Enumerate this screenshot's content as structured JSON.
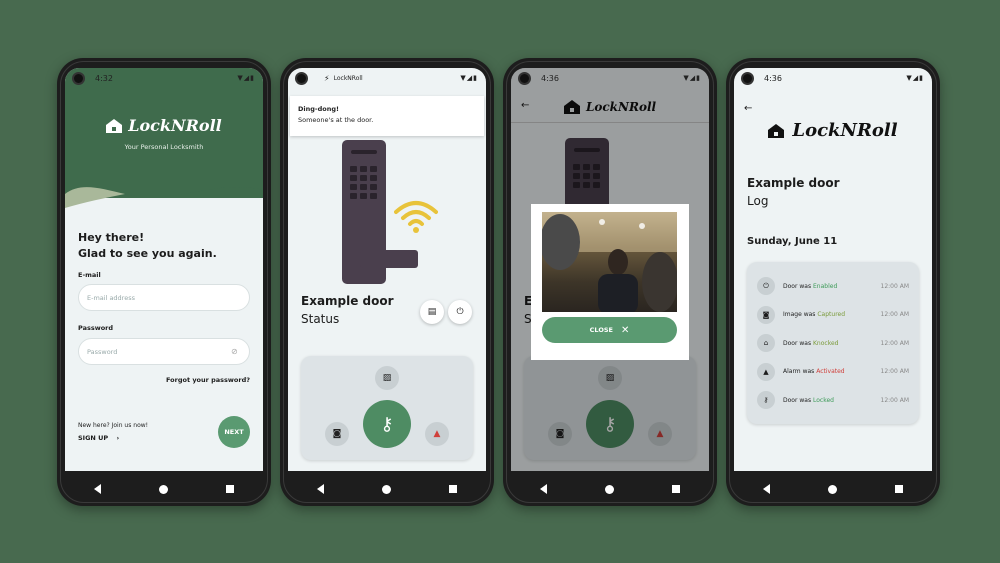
{
  "colors": {
    "background": "#486a4f",
    "brand": "#3f6b4c",
    "accent": "#5a9a71",
    "danger": "#d0403b"
  },
  "app": {
    "name": "LockNRoll",
    "tagline": "Your Personal Locksmith"
  },
  "screen1": {
    "time": "4:32",
    "greeting_line1": "Hey there!",
    "greeting_line2": "Glad to see you again.",
    "email_label": "E-mail",
    "email_placeholder": "E-mail address",
    "password_label": "Password",
    "password_placeholder": "Password",
    "forgot": "Forgot your password?",
    "new_here": "New here? Join us now!",
    "signup": "SIGN UP",
    "next": "NEXT"
  },
  "screen2": {
    "notif_app": "LockNRoll",
    "notif_title": "Ding-dong!",
    "notif_body": "Someone's at the door.",
    "door_title": "Example door",
    "door_subtitle": "Status"
  },
  "screen3": {
    "time": "4:36",
    "close": "CLOSE"
  },
  "screen4": {
    "time": "4:36",
    "title": "Example door",
    "subtitle": "Log",
    "date": "Sunday, June 11",
    "entries": [
      {
        "icon": "power-icon",
        "subject": "Door",
        "verb": "was",
        "action": "Enabled",
        "time": "12:00 AM"
      },
      {
        "icon": "camera-icon",
        "subject": "Image",
        "verb": "was",
        "action": "Captured",
        "time": "12:00 AM"
      },
      {
        "icon": "door-icon",
        "subject": "Door",
        "verb": "was",
        "action": "Knocked",
        "time": "12:00 AM"
      },
      {
        "icon": "warning-icon",
        "subject": "Alarm",
        "verb": "was",
        "action": "Activated",
        "time": "12:00 AM"
      },
      {
        "icon": "key-icon",
        "subject": "Door",
        "verb": "was",
        "action": "Locked",
        "time": "12:00 AM"
      }
    ]
  }
}
